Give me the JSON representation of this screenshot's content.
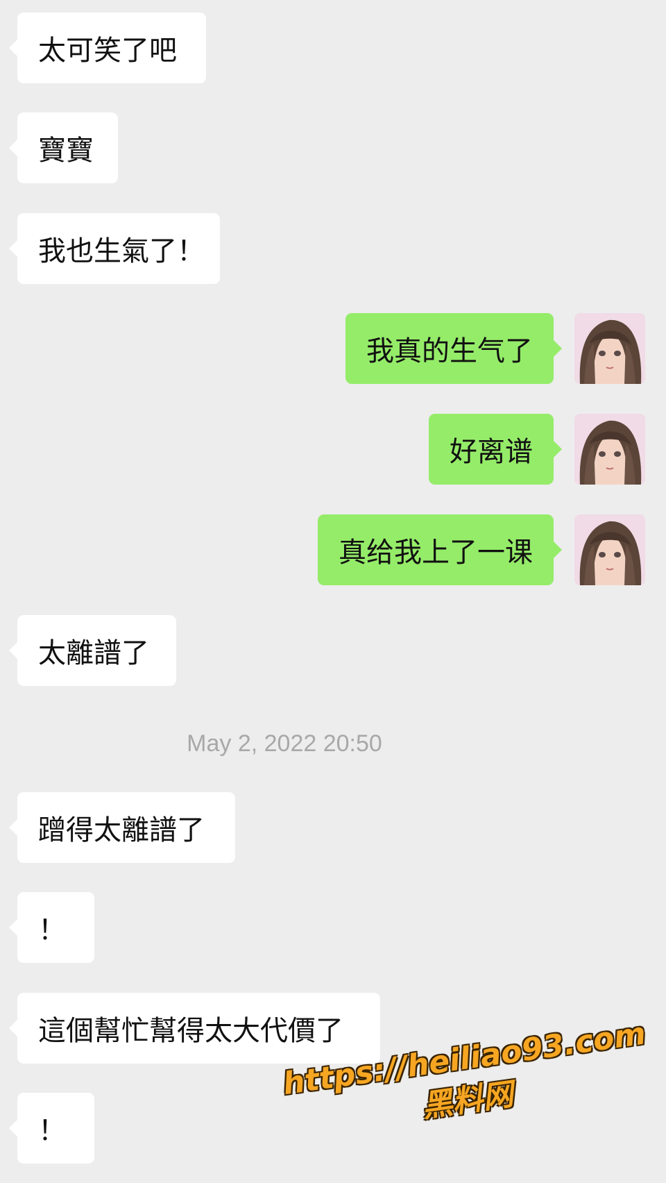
{
  "colors": {
    "background": "#ededed",
    "incoming_bubble": "#ffffff",
    "outgoing_bubble": "#95ec69",
    "timestamp_text": "#a8a8a8",
    "watermark_text": "#f6a622"
  },
  "messages_before": [
    {
      "side": "in",
      "text": "太可笑了吧"
    },
    {
      "side": "in",
      "text": "寶寶"
    },
    {
      "side": "in",
      "text": "我也生氣了！"
    },
    {
      "side": "out",
      "text": "我真的生气了",
      "avatar": "anime-girl-avatar"
    },
    {
      "side": "out",
      "text": "好离谱",
      "avatar": "anime-girl-avatar"
    },
    {
      "side": "out",
      "text": "真给我上了一课",
      "avatar": "anime-girl-avatar"
    },
    {
      "side": "in",
      "text": "太離譜了"
    }
  ],
  "timestamp": "May 2, 2022 20:50",
  "messages_after": [
    {
      "side": "in",
      "text": "蹭得太離譜了"
    },
    {
      "side": "in",
      "text": "！"
    },
    {
      "side": "in",
      "text": "這個幫忙幫得太大代價了"
    },
    {
      "side": "in",
      "text": "！"
    }
  ],
  "watermark": {
    "url": "https://heiliao93.com",
    "site_name": "黑料网"
  }
}
